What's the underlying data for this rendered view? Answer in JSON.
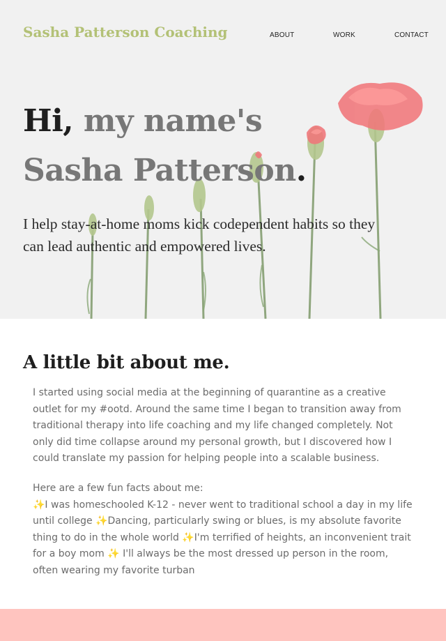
{
  "brand": "Sasha Patterson Coaching",
  "nav": {
    "about": "ABOUT",
    "work": "WORK",
    "contact": "CONTACT"
  },
  "hero": {
    "greeting": "Hi,",
    "title_rest": " my name's",
    "name": "Sasha Patterson",
    "name_period": ".",
    "subtitle": "I help stay-at-home moms kick codependent habits so they can lead authentic and empowered lives."
  },
  "about": {
    "heading": "A little bit about me.",
    "paragraph1": "I started using social media at the beginning of quarantine as a creative outlet for my #ootd. Around the same time I began to transition away from traditional therapy into life coaching and my life changed completely. Not only did time collapse around my personal growth, but I discovered how I could translate my passion for helping people into a scalable business.",
    "facts_intro": "Here are a few fun facts about me:",
    "facts": "✨I was homeschooled K-12 - never went to traditional school a day in my life until college ✨Dancing, particularly swing or blues, is my absolute favorite thing to do in the whole world ✨I'm terrified of heights, an inconvenient trait for a boy mom ✨ I'll always be the most dressed up person in the room, often wearing my favorite turban"
  },
  "colors": {
    "brand": "#b3c176",
    "footer_band": "#ffc4bf",
    "flower": "#f0767a"
  }
}
